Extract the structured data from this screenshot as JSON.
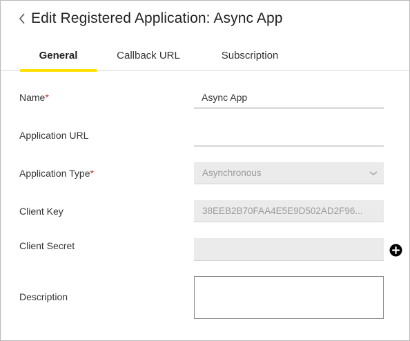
{
  "header": {
    "title": "Edit Registered Application: Async App",
    "back_icon": "chevron-left-icon"
  },
  "tabs": [
    {
      "label": "General",
      "active": true
    },
    {
      "label": "Callback URL",
      "active": false
    },
    {
      "label": "Subscription",
      "active": false
    }
  ],
  "form": {
    "name": {
      "label": "Name",
      "required_mark": "*",
      "value": "Async App"
    },
    "application_url": {
      "label": "Application URL",
      "value": ""
    },
    "application_type": {
      "label": "Application Type",
      "required_mark": "*",
      "value": "Asynchronous",
      "icon": "chevron-down-icon"
    },
    "client_key": {
      "label": "Client Key",
      "value": "38EEB2B70FAA4E5E9D502AD2F96..."
    },
    "client_secret": {
      "label": "Client Secret",
      "value": "",
      "add_icon": "plus-circle-icon"
    },
    "description": {
      "label": "Description",
      "value": ""
    }
  },
  "colors": {
    "accent_underline": "#ffe000",
    "required": "#c0392b",
    "disabled_field_bg": "#ebebeb"
  }
}
